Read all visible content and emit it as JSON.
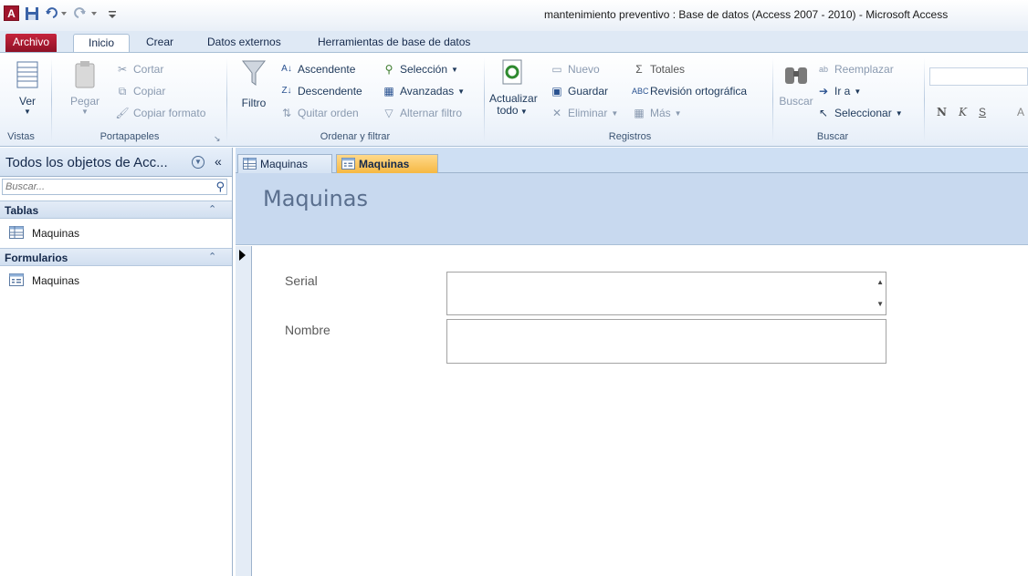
{
  "window": {
    "title": "mantenimiento preventivo : Base de datos (Access 2007 - 2010)  -  Microsoft Access",
    "logo": "A"
  },
  "quick_access": [
    "save-icon",
    "undo-icon",
    "redo-icon",
    "customize-icon"
  ],
  "ribbon_tabs": [
    "Archivo",
    "Inicio",
    "Crear",
    "Datos externos",
    "Herramientas de base de datos"
  ],
  "ribbon": {
    "vistas": {
      "label": "Vistas",
      "ver": "Ver"
    },
    "portapapeles": {
      "label": "Portapapeles",
      "pegar": "Pegar",
      "cortar": "Cortar",
      "copiar": "Copiar",
      "copiar_formato": "Copiar formato"
    },
    "ordenar": {
      "label": "Ordenar y filtrar",
      "filtro": "Filtro",
      "ascendente": "Ascendente",
      "descendente": "Descendente",
      "quitar_orden": "Quitar orden",
      "seleccion": "Selección",
      "avanzadas": "Avanzadas",
      "alternar_filtro": "Alternar filtro"
    },
    "registros": {
      "label": "Registros",
      "actualizar": "Actualizar",
      "todo": "todo",
      "nuevo": "Nuevo",
      "guardar": "Guardar",
      "eliminar": "Eliminar",
      "totales": "Totales",
      "revision": "Revisión ortográfica",
      "mas": "Más"
    },
    "buscar": {
      "label": "Buscar",
      "buscar": "Buscar",
      "reemplazar": "Reemplazar",
      "ir_a": "Ir a",
      "seleccionar": "Seleccionar"
    },
    "formato": {
      "bold": "N",
      "italic": "K",
      "underline": "S",
      "font_a": "A"
    }
  },
  "nav": {
    "title": "Todos los objetos de Acc...",
    "search_placeholder": "Buscar...",
    "sections": [
      {
        "label": "Tablas",
        "items": [
          "Maquinas"
        ]
      },
      {
        "label": "Formularios",
        "items": [
          "Maquinas"
        ]
      }
    ]
  },
  "doc_tabs": [
    "Maquinas",
    "Maquinas"
  ],
  "form": {
    "title": "Maquinas",
    "fields": [
      {
        "label": "Serial",
        "value": ""
      },
      {
        "label": "Nombre",
        "value": ""
      }
    ]
  },
  "colors": {
    "file_tab": "#a0152c",
    "active_doc_tab": "#f6b843",
    "form_header": "#c8d9ef"
  }
}
